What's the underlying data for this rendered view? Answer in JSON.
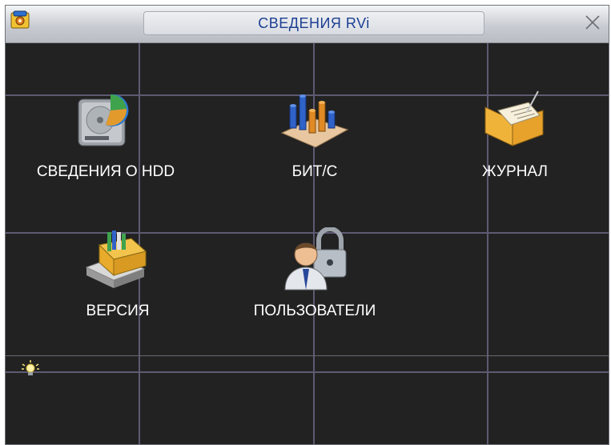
{
  "window": {
    "title": "СВЕДЕНИЯ RVi",
    "title_icon": "lock-settings-icon",
    "close_icon": "close-icon"
  },
  "items": [
    {
      "label": "СВЕДЕНИЯ О HDD",
      "icon": "hdd-icon"
    },
    {
      "label": "БИТ/С",
      "icon": "bar-chart-icon"
    },
    {
      "label": "ЖУРНАЛ",
      "icon": "log-folder-icon"
    },
    {
      "label": "ВЕРСИЯ",
      "icon": "version-box-icon"
    },
    {
      "label": "ПОЛЬЗОВАТЕЛИ",
      "icon": "users-lock-icon"
    }
  ],
  "status": {
    "tip_icon": "lightbulb-icon"
  },
  "colors": {
    "background": "#222222",
    "title_text": "#1d3f93",
    "label_text": "#ffffff",
    "grid_lines": "#5d5a72"
  }
}
